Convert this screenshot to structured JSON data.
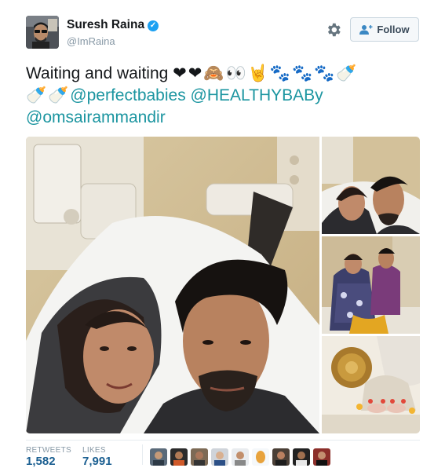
{
  "user": {
    "name": "Suresh Raina",
    "handle": "@ImRaina",
    "verified": true
  },
  "follow_button": {
    "label": "Follow",
    "icon": "user-plus-icon"
  },
  "settings_icon": "gear-icon",
  "tweet": {
    "text": "Waiting and waiting",
    "emoji_line_1": "❤❤🙈👀🤘🐾🐾🐾🍼",
    "emoji_line_2": "🍼🍼",
    "mentions": [
      "@perfectbabies",
      "@HEALTHYBABy",
      "@omsairammandir"
    ]
  },
  "media": {
    "photos": [
      "hospital-selfie",
      "couple-selfie",
      "couple-on-bed",
      "ganesha-idol"
    ]
  },
  "stats": {
    "retweets_label": "RETWEETS",
    "retweets_value": "1,582",
    "likes_label": "LIKES",
    "likes_value": "7,991"
  },
  "likers_count_shown": 9,
  "colors": {
    "link": "#1b95a0",
    "stat_value": "#1b5f91",
    "verified_badge": "#1da1f2",
    "muted_text": "#8899a6"
  }
}
